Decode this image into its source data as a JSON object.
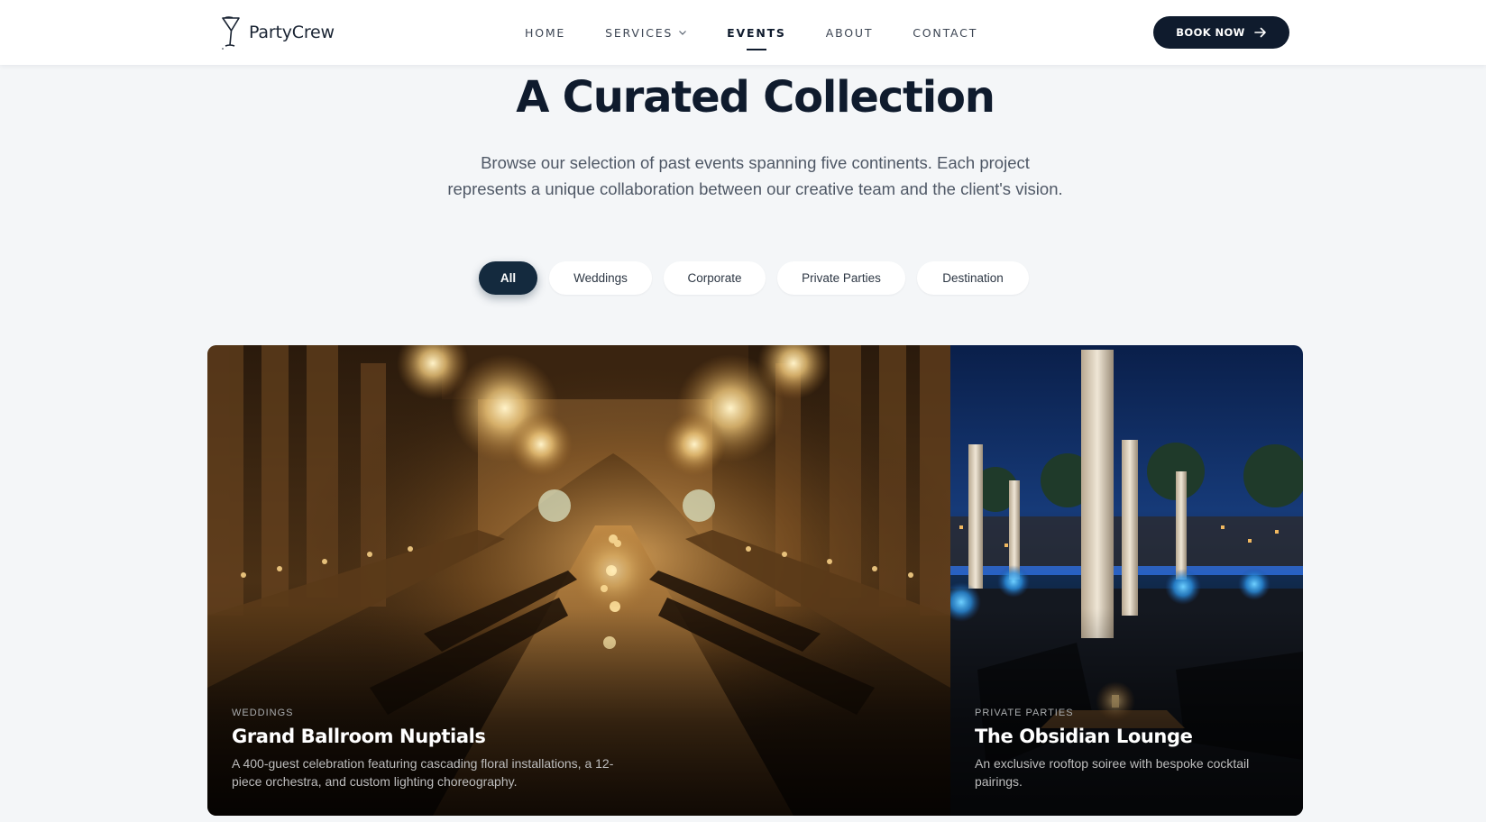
{
  "brand": {
    "name": "PartyCrew",
    "logo_icon": "cocktail-glass-icon"
  },
  "nav": {
    "items": [
      {
        "label": "HOME",
        "active": false
      },
      {
        "label": "SERVICES",
        "active": false,
        "has_dropdown": true
      },
      {
        "label": "EVENTS",
        "active": true
      },
      {
        "label": "ABOUT",
        "active": false
      },
      {
        "label": "CONTACT",
        "active": false
      }
    ],
    "cta_label": "BOOK NOW",
    "cta_icon": "arrow-right-icon"
  },
  "hero": {
    "title": "A Curated Collection",
    "subtitle": "Browse our selection of past events spanning five continents. Each project represents a unique collaboration between our creative team and the client's vision."
  },
  "filters": [
    {
      "label": "All",
      "active": true
    },
    {
      "label": "Weddings",
      "active": false
    },
    {
      "label": "Corporate",
      "active": false
    },
    {
      "label": "Private Parties",
      "active": false
    },
    {
      "label": "Destination",
      "active": false
    }
  ],
  "events": [
    {
      "category": "WEDDINGS",
      "title": "Grand Ballroom Nuptials",
      "description": "A 400-guest celebration featuring cascading floral installations, a 12-piece orchestra, and custom lighting choreography."
    },
    {
      "category": "PRIVATE PARTIES",
      "title": "The Obsidian Lounge",
      "description": "An exclusive rooftop soiree with bespoke cocktail pairings."
    }
  ],
  "colors": {
    "navy": "#0f1b2d",
    "pill_active": "#142a3e",
    "page_bg": "#f4f6f8"
  }
}
